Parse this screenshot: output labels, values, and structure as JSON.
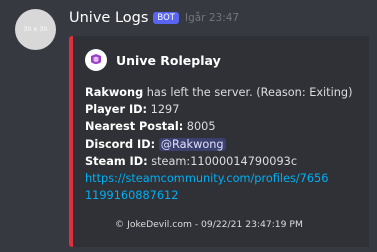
{
  "message": {
    "avatar_text": "30 x 30",
    "username": "Unive Logs",
    "bot_tag": "BOT",
    "timestamp": "Igår 23:47"
  },
  "embed": {
    "bar_color": "#e0303b",
    "author": {
      "icon": "roleplay-logo-icon",
      "name": "Unive Roleplay"
    },
    "leave": {
      "name": "Rakwong",
      "text": " has left the server. (Reason: Exiting)"
    },
    "fields": {
      "player_id": {
        "label": "Player ID:",
        "value": " 1297"
      },
      "nearest_postal": {
        "label": "Nearest Postal:",
        "value": " 8005"
      },
      "discord_id": {
        "label": "Discord ID:",
        "value": "@Rakwong"
      },
      "steam_id": {
        "label": "Steam ID:",
        "value": " steam:11000014790093c"
      }
    },
    "profile_link_line1": "https://steamcommunity.com/profiles/7656",
    "profile_link_line2": "1199160887612",
    "footer": "© JokeDevil.com - 09/22/21 23:47:19 PM"
  },
  "colors": {
    "background": "#36393f",
    "embed_background": "#2f3136",
    "bot_tag": "#5865f2",
    "link": "#00aff4",
    "logo": "#9b3fc8"
  }
}
